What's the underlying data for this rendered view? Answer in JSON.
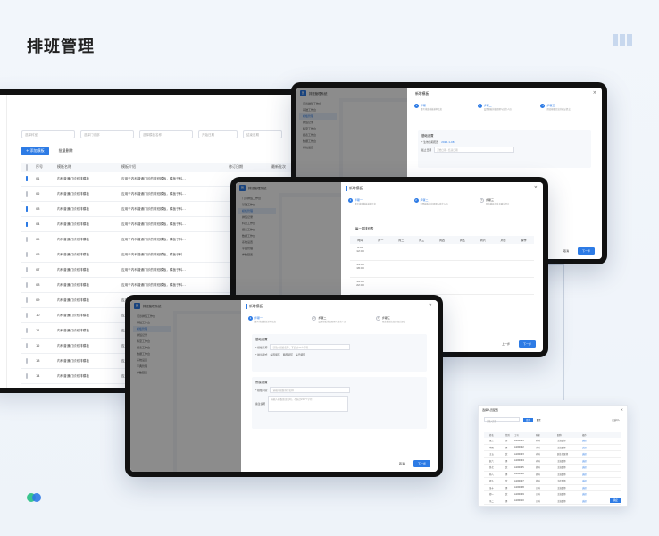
{
  "page": {
    "title": "排班管理"
  },
  "list_window": {
    "filters": [
      "选择科室",
      "选择门诊部",
      "选择模板名称",
      "开始日期",
      "结束日期"
    ],
    "search_label": "查询",
    "add_label": "+ 添加模板",
    "batch_delete_label": "批量删除",
    "columns": [
      "序号",
      "模板名称",
      "模板介绍",
      "修订日期",
      "最新批次"
    ],
    "rows": [
      {
        "no": "01",
        "name": "内科普通门诊班排模板",
        "intro": "应用于内科普通门诊的排班模板，模板于科...",
        "checked": true
      },
      {
        "no": "02",
        "name": "内科普通门诊班排模板",
        "intro": "应用于内科普通门诊的排班模板，模板于科...",
        "checked": false
      },
      {
        "no": "03",
        "name": "内科普通门诊班排模板",
        "intro": "应用于内科普通门诊的排班模板，模板于科...",
        "checked": true
      },
      {
        "no": "04",
        "name": "内科普通门诊班排模板",
        "intro": "应用于内科普通门诊的排班模板，模板于科...",
        "checked": true
      },
      {
        "no": "05",
        "name": "内科普通门诊班排模板",
        "intro": "应用于内科普通门诊的排班模板，模板于科...",
        "checked": false
      },
      {
        "no": "06",
        "name": "内科普通门诊班排模板",
        "intro": "应用于内科普通门诊的排班模板，模板于科...",
        "checked": false
      },
      {
        "no": "07",
        "name": "内科普通门诊班排模板",
        "intro": "应用于内科普通门诊的排班模板，模板于科...",
        "checked": false
      },
      {
        "no": "08",
        "name": "内科普通门诊班排模板",
        "intro": "应用于内科普通门诊的排班模板，模板于科...",
        "checked": false
      },
      {
        "no": "09",
        "name": "内科普通门诊班排模板",
        "intro": "应用于内科普通门诊的排班模板，模板于科...",
        "checked": false
      },
      {
        "no": "10",
        "name": "内科普通门诊班排模板",
        "intro": "应用于内科普通门诊的排班模板，模板于科...",
        "checked": false
      },
      {
        "no": "11",
        "name": "内科普通门诊班排模板",
        "intro": "应用于内科普通门诊的排班模板，模板于科...",
        "checked": false
      },
      {
        "no": "12",
        "name": "内科普通门诊班排模板",
        "intro": "应用于内科普通门诊的排班模板，模板于科...",
        "checked": false
      },
      {
        "no": "13",
        "name": "内科普通门诊班排模板",
        "intro": "应用于内科普通门诊的排班模板，模板于科...",
        "checked": false
      },
      {
        "no": "14",
        "name": "内科普通门诊班排模板",
        "intro": "应用于内科普通门诊的排班模板，模板于科...",
        "checked": false
      },
      {
        "no": "15",
        "name": "内科普通门诊班排模板",
        "intro": "应用于内科普通门诊的排班模板，模板于科...",
        "checked": false
      }
    ]
  },
  "app": {
    "name": "排班管理系统",
    "logo": "医",
    "sidebar": [
      "门诊排班工作台",
      "基础工作台",
      "模板管理",
      "排班记录",
      "科室工作台",
      "报表工作台",
      "数据工作台",
      "系统设置",
      "字典管理",
      "参数配置"
    ]
  },
  "drawer": {
    "title": "新增模板",
    "close": "×",
    "steps": [
      {
        "num": "1",
        "label": "步骤一",
        "desc": "填写排班模板基本信息"
      },
      {
        "num": "2",
        "label": "步骤二",
        "desc": "设置模板排班周期与班次人员"
      },
      {
        "num": "3",
        "label": "步骤三",
        "desc": "预览模板信息并确认提交"
      }
    ],
    "cancel": "取消",
    "next": "下一步",
    "prev": "上一步"
  },
  "tablet_top": {
    "section": "基础设置",
    "fields": [
      {
        "label": "* 生效日期配置",
        "value": "2022-1-08"
      },
      {
        "label": "截止日期",
        "value": "开始日期 - 结束日期"
      }
    ]
  },
  "tablet_mid": {
    "grid_title": "每一周排班表",
    "days": [
      "时间",
      "周一",
      "周二",
      "周三",
      "周四",
      "周五",
      "周六",
      "周日",
      "操作"
    ],
    "times": [
      "8:00\n12:00",
      "14:00\n18:00",
      "19:00\n22:00"
    ]
  },
  "tablet_bottom": {
    "section1": "基础设置",
    "field_name_label": "* 模板名称",
    "field_name_placeholder": "请输入模板名称，不超过20个字符",
    "field_type_label": "* 排班模式",
    "field_type_options": [
      "每周循环",
      "两周循环",
      "每日循环"
    ],
    "section2": "所属设置",
    "field_dept_label": "* 模板科室",
    "field_dept_placeholder": "请输入模板科室名称",
    "field_remark_label": "备注说明",
    "field_remark_placeholder": "请输入模板备注说明，不超过200个字符"
  },
  "popup": {
    "title": "选择人员配置",
    "close": "×",
    "search_placeholder": "请输入姓名",
    "selected_label": "已选0人",
    "query": "查询",
    "reset": "重置",
    "columns": [
      "",
      "姓名",
      "性别",
      "工号",
      "科室",
      "职称",
      "操作"
    ],
    "rows": [
      [
        "",
        "张三",
        "男",
        "A100001",
        "内科",
        "主治医师",
        "选择"
      ],
      [
        "",
        "李四",
        "男",
        "A100002",
        "内科",
        "主治医师",
        "选择"
      ],
      [
        "",
        "王五",
        "女",
        "A100003",
        "内科",
        "副主任医师",
        "选择"
      ],
      [
        "",
        "赵六",
        "男",
        "A100004",
        "内科",
        "主治医师",
        "选择"
      ],
      [
        "",
        "钱七",
        "女",
        "A100005",
        "外科",
        "主治医师",
        "选择"
      ],
      [
        "",
        "孙八",
        "男",
        "A100006",
        "外科",
        "主治医师",
        "选择"
      ],
      [
        "",
        "周九",
        "女",
        "A100007",
        "外科",
        "主任医师",
        "选择"
      ],
      [
        "",
        "吴十",
        "男",
        "A100008",
        "儿科",
        "主治医师",
        "选择"
      ],
      [
        "",
        "郑一",
        "女",
        "A100009",
        "儿科",
        "主治医师",
        "选择"
      ],
      [
        "",
        "冯二",
        "男",
        "A100010",
        "儿科",
        "主治医师",
        "选择"
      ]
    ],
    "confirm": "确定"
  }
}
